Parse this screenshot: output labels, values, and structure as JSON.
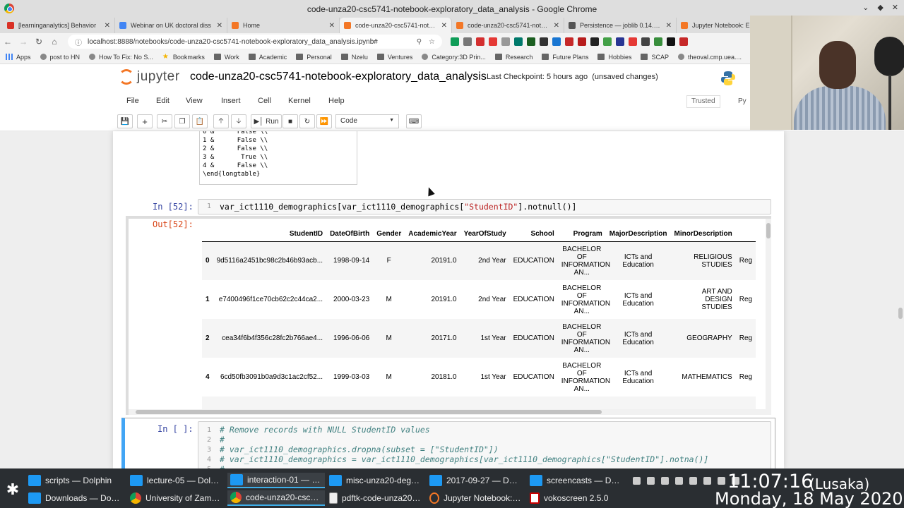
{
  "window": {
    "title": "code-unza20-csc5741-notebook-exploratory_data_analysis - Google Chrome"
  },
  "tabs": [
    {
      "label": "[learninganalytics] Behavior",
      "icon": "gmail-icon",
      "color": "#d93025"
    },
    {
      "label": "Webinar on UK doctoral diss",
      "icon": "doc-icon",
      "color": "#4285f4"
    },
    {
      "label": "Home",
      "icon": "jupyter-icon",
      "color": "#f37726"
    },
    {
      "label": "code-unza20-csc5741-notebo",
      "icon": "jupyter-icon",
      "color": "#f37726",
      "active": true
    },
    {
      "label": "code-unza20-csc5741-notebo",
      "icon": "jupyter-icon",
      "color": "#f37726"
    },
    {
      "label": "Persistence — joblib 0.14.1.dev",
      "icon": "joblib-icon",
      "color": "#555"
    },
    {
      "label": "Jupyter Notebook: E",
      "icon": "jupyter-icon",
      "color": "#f37726"
    }
  ],
  "address": {
    "url": "localhost:8888/notebooks/code-unza20-csc5741-notebook-exploratory_data_analysis.ipynb#"
  },
  "bookmarks": [
    {
      "label": "Apps",
      "type": "apps"
    },
    {
      "label": "post to HN",
      "type": "page"
    },
    {
      "label": "How To Fix: No S...",
      "type": "page"
    },
    {
      "label": "Bookmarks",
      "type": "star"
    },
    {
      "label": "Work",
      "type": "folder"
    },
    {
      "label": "Academic",
      "type": "folder"
    },
    {
      "label": "Personal",
      "type": "folder"
    },
    {
      "label": "Nzelu",
      "type": "folder"
    },
    {
      "label": "Ventures",
      "type": "folder"
    },
    {
      "label": "Category:3D Prin...",
      "type": "page"
    },
    {
      "label": "Research",
      "type": "folder"
    },
    {
      "label": "Future Plans",
      "type": "folder"
    },
    {
      "label": "Hobbies",
      "type": "folder"
    },
    {
      "label": "SCAP",
      "type": "folder"
    },
    {
      "label": "theoval.cmp.uea....",
      "type": "page"
    }
  ],
  "jupyter": {
    "logo_text": "jupyter",
    "notebook_name": "code-unza20-csc5741-notebook-exploratory_data_analysis",
    "checkpoint": "Last Checkpoint: 5 hours ago",
    "unsaved": "(unsaved changes)",
    "menu": [
      "File",
      "Edit",
      "View",
      "Insert",
      "Cell",
      "Kernel",
      "Help"
    ],
    "trusted": "Trusted",
    "kernel_indicator": "Py",
    "run_label": "Run",
    "cell_type": "Code"
  },
  "latex_lines": [
    "0 &      False \\\\",
    "1 &      False \\\\",
    "2 &      False \\\\",
    "3 &       True \\\\",
    "4 &      False \\\\",
    "\\end{longtable}"
  ],
  "cell52": {
    "in_prompt": "In [52]:",
    "out_prompt": "Out[52]:",
    "line_no": "1",
    "code_pre": "var_ict1110_demographics[var_ict1110_demographics[",
    "code_str": "\"StudentID\"",
    "code_post": "].notnull()]"
  },
  "dataframe": {
    "columns": [
      "",
      "StudentID",
      "DateOfBirth",
      "Gender",
      "AcademicYear",
      "YearOfStudy",
      "School",
      "Program",
      "MajorDescription",
      "MinorDescription",
      ""
    ],
    "rows": [
      {
        "idx": "0",
        "id": "9d5116a2451bc98c2b46b93acb...",
        "dob": "1998-09-14",
        "gender": "F",
        "year": "20191.0",
        "study": "2nd Year",
        "school": "EDUCATION",
        "program": "BACHELOR OF INFORMATION AN...",
        "major": "ICTs and Education",
        "minor": "RELIGIOUS STUDIES",
        "extra": "Reg"
      },
      {
        "idx": "1",
        "id": "e7400496f1ce70cb62c2c44ca2...",
        "dob": "2000-03-23",
        "gender": "M",
        "year": "20191.0",
        "study": "2nd Year",
        "school": "EDUCATION",
        "program": "BACHELOR OF INFORMATION AN...",
        "major": "ICTs and Education",
        "minor": "ART AND DESIGN STUDIES",
        "extra": "Reg"
      },
      {
        "idx": "2",
        "id": "cea34f6b4f356c28fc2b766ae4...",
        "dob": "1996-06-06",
        "gender": "M",
        "year": "20171.0",
        "study": "1st Year",
        "school": "EDUCATION",
        "program": "BACHELOR OF INFORMATION AN...",
        "major": "ICTs and Education",
        "minor": "GEOGRAPHY",
        "extra": "Reg"
      },
      {
        "idx": "4",
        "id": "6cd50fb3091b0a9d3c1ac2cf52...",
        "dob": "1999-03-03",
        "gender": "M",
        "year": "20181.0",
        "study": "1st Year",
        "school": "EDUCATION",
        "program": "BACHELOR OF INFORMATION AN...",
        "major": "ICTs and Education",
        "minor": "MATHEMATICS",
        "extra": "Reg"
      },
      {
        "idx": "",
        "id": "",
        "dob": "",
        "gender": "",
        "year": "",
        "study": "",
        "school": "",
        "program": "BACHELOR",
        "major": "",
        "minor": "",
        "extra": ""
      }
    ]
  },
  "cell_next": {
    "in_prompt": "In [ ]:",
    "lines": [
      {
        "no": "1",
        "text": "# Remove records with NULL StudentID values"
      },
      {
        "no": "2",
        "text": "#"
      },
      {
        "no": "3",
        "text": "# var_ict1110_demographics.dropna(subset = [\"StudentID\"])"
      },
      {
        "no": "4",
        "text": "# var_ict1110_demographics = var_ict1110_demographics[var_ict1110_demographics[\"StudentID\"].notna()]"
      },
      {
        "no": "5",
        "text": "#"
      }
    ]
  },
  "taskbar": {
    "tasks_top": [
      {
        "label": "scripts — Dolphin",
        "icon": "dolphin"
      },
      {
        "label": "lecture-05 — Dolphin",
        "icon": "dolphin"
      },
      {
        "label": "interaction-01 — Dol...",
        "icon": "dolphin",
        "active": true
      },
      {
        "label": "misc-unza20-degree...",
        "icon": "dolphin"
      },
      {
        "label": "2017-09-27 — Dolphin",
        "icon": "dolphin"
      },
      {
        "label": "screencasts — Dolp...",
        "icon": "dolphin"
      }
    ],
    "tasks_bottom": [
      {
        "label": "Downloads — Dolph...",
        "icon": "dolphin"
      },
      {
        "label": "University of Zambi...",
        "icon": "chrome"
      },
      {
        "label": "code-unza20-csc574...",
        "icon": "chrome",
        "active": true
      },
      {
        "label": "pdftk-code-unza20-c...",
        "icon": "pdf"
      },
      {
        "label": "Jupyter Notebook: E...",
        "icon": "jupyter"
      },
      {
        "label": "vokoscreen 2.5.0",
        "icon": "voko"
      }
    ],
    "time": "11:07:16",
    "timezone": "(Lusaka)",
    "date": "Monday, 18 May 2020"
  }
}
